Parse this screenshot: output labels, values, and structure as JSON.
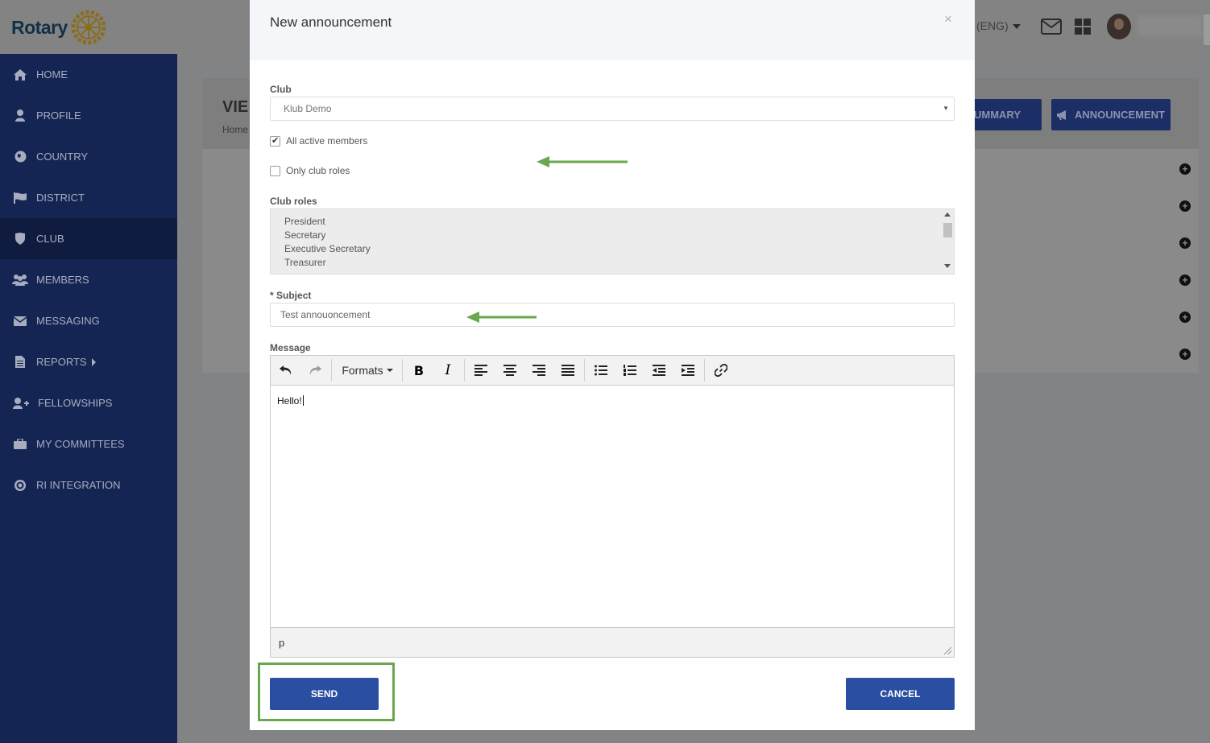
{
  "app": {
    "logo_text": "Rotary",
    "language": "(ENG)"
  },
  "sidebar": {
    "items": [
      {
        "label": "HOME",
        "icon": "home-icon"
      },
      {
        "label": "PROFILE",
        "icon": "user-icon"
      },
      {
        "label": "COUNTRY",
        "icon": "globe-icon"
      },
      {
        "label": "DISTRICT",
        "icon": "flag-icon"
      },
      {
        "label": "CLUB",
        "icon": "shield-icon",
        "active": true
      },
      {
        "label": "MEMBERS",
        "icon": "users-icon"
      },
      {
        "label": "MESSAGING",
        "icon": "envelope-icon"
      },
      {
        "label": "REPORTS",
        "icon": "document-icon"
      },
      {
        "label": "FELLOWSHIPS",
        "icon": "user-plus-icon"
      },
      {
        "label": "MY COMMITTEES",
        "icon": "briefcase-icon"
      },
      {
        "label": "RI INTEGRATION",
        "icon": "target-icon"
      }
    ]
  },
  "page": {
    "title": "VIE",
    "breadcrumb": "Home",
    "summary_button": "SUMMARY",
    "announcement_button": "ANNOUNCEMENT"
  },
  "modal": {
    "title": "New announcement",
    "close": "×",
    "club_label": "Club",
    "club_value": "Klub Demo",
    "all_active_members": "All active members",
    "only_club_roles": "Only club roles",
    "club_roles_label": "Club roles",
    "club_roles": [
      "President",
      "Secretary",
      "Executive Secretary",
      "Treasurer"
    ],
    "subject_required": "*",
    "subject_label": "Subject",
    "subject_value": "Test annouoncement",
    "message_label": "Message",
    "formats_label": "Formats",
    "message_body": "Hello!",
    "status_path": "p",
    "send_label": "SEND",
    "cancel_label": "CANCEL"
  },
  "colors": {
    "sidebar": "#152553",
    "primary_button": "#2a4ea1",
    "annotation_green": "#6aa84f"
  }
}
